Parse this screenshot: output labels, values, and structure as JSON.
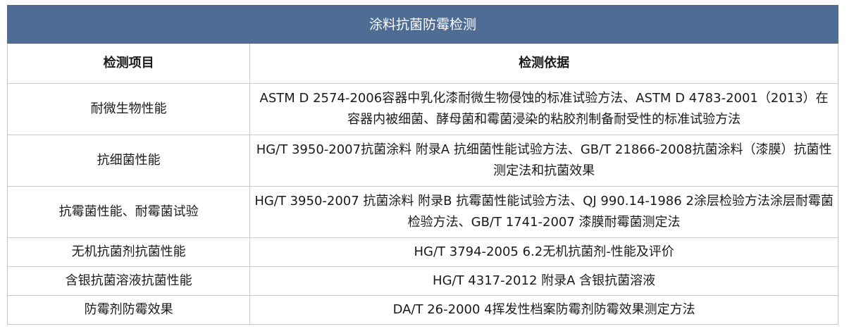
{
  "table": {
    "title": "涂料抗菌防霉检测",
    "headers": [
      "检测项目",
      "检测依据"
    ],
    "rows": [
      {
        "item": "耐微生物性能",
        "basis": "ASTM D 2574-2006容器中乳化漆耐微生物侵蚀的标准试验方法、ASTM D 4783-2001（2013）在容器内被细菌、酵母菌和霉菌浸染的粘胶剂制备耐受性的标准试验方法"
      },
      {
        "item": "抗细菌性能",
        "basis": "HG/T 3950-2007抗菌涂料 附录A 抗细菌性能试验方法、GB/T 21866-2008抗菌涂料（漆膜）抗菌性测定法和抗菌效果"
      },
      {
        "item": "抗霉菌性能、耐霉菌试验",
        "basis": "HG/T 3950-2007 抗菌涂料 附录B 抗霉菌性能试验方法、QJ 990.14-1986 2涂层检验方法涂层耐霉菌检验方法、GB/T 1741-2007 漆膜耐霉菌测定法"
      },
      {
        "item": "无机抗菌剂抗菌性能",
        "basis": "HG/T 3794-2005 6.2无机抗菌剂-性能及评价"
      },
      {
        "item": "含银抗菌溶液抗菌性能",
        "basis": "HG/T 4317-2012 附录A 含银抗菌溶液"
      },
      {
        "item": "防霉剂防霉效果",
        "basis": "DA/T 26-2000 4挥发性档案防霉剂防霉效果测定方法"
      }
    ]
  }
}
